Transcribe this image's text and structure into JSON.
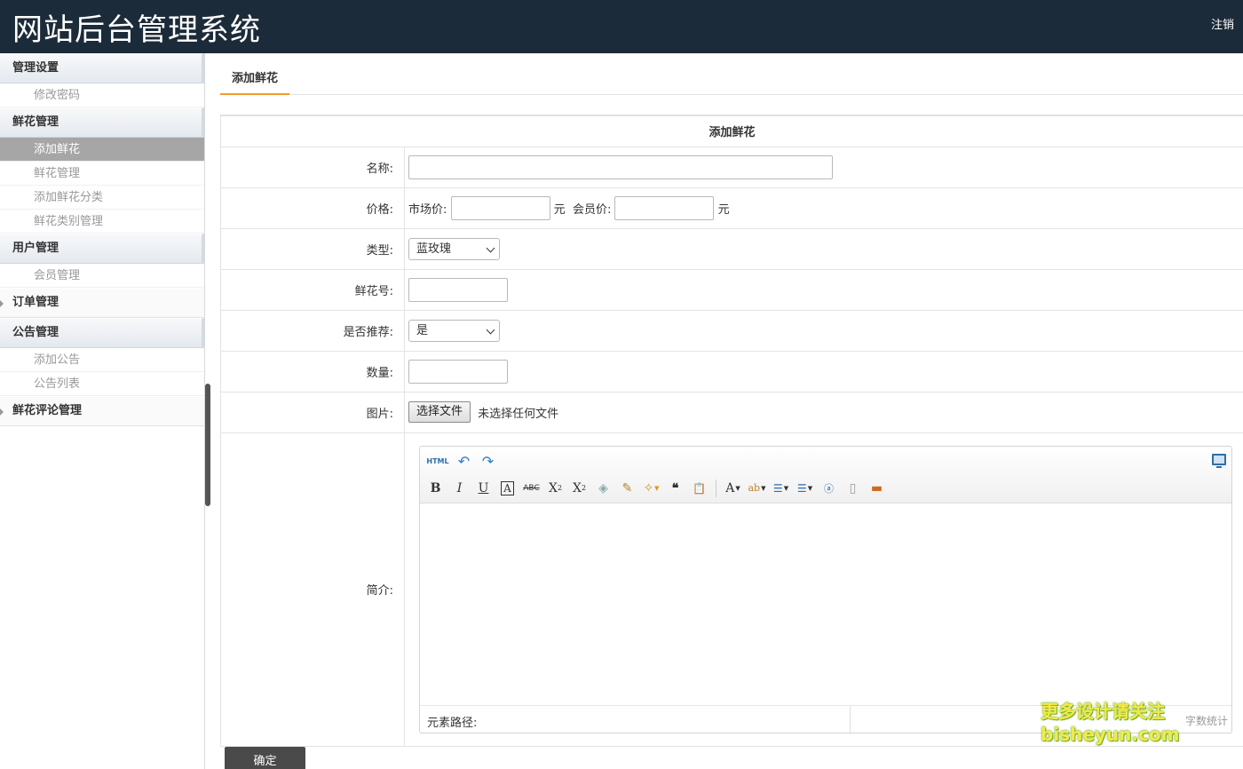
{
  "header": {
    "title": "网站后台管理系统",
    "logout_label": "注销"
  },
  "sidebar": {
    "groups": [
      {
        "label": "管理设置",
        "items": [
          {
            "label": "修改密码"
          }
        ]
      },
      {
        "label": "鲜花管理",
        "items": [
          {
            "label": "添加鲜花",
            "active": true
          },
          {
            "label": "鲜花管理"
          },
          {
            "label": "添加鲜花分类"
          },
          {
            "label": "鲜花类别管理"
          }
        ]
      },
      {
        "label": "用户管理",
        "items": [
          {
            "label": "会员管理"
          }
        ]
      },
      {
        "label": "订单管理",
        "items": []
      },
      {
        "label": "公告管理",
        "items": [
          {
            "label": "添加公告"
          },
          {
            "label": "公告列表"
          }
        ]
      },
      {
        "label": "鲜花评论管理",
        "items": []
      }
    ]
  },
  "tab": {
    "label": "添加鲜花"
  },
  "form": {
    "caption": "添加鲜花",
    "name_label": "名称:",
    "name_value": "",
    "price_label": "价格:",
    "market_price_label": "市场价:",
    "market_price_value": "",
    "currency_unit": "元",
    "member_price_label": "会员价:",
    "member_price_value": "",
    "type_label": "类型:",
    "type_selected": "蓝玫瑰",
    "flower_no_label": "鲜花号:",
    "flower_no_value": "",
    "recommend_label": "是否推荐:",
    "recommend_selected": "是",
    "quantity_label": "数量:",
    "quantity_value": "",
    "image_label": "图片:",
    "file_button": "选择文件",
    "file_status": "未选择任何文件",
    "intro_label": "简介:",
    "editor": {
      "html_button": "HTML",
      "element_path_label": "元素路径:",
      "word_count_label": "字数统计"
    },
    "submit_label": "确定"
  },
  "watermark": {
    "line1": "更多设计请关注",
    "line2": "bisheyun.com"
  }
}
